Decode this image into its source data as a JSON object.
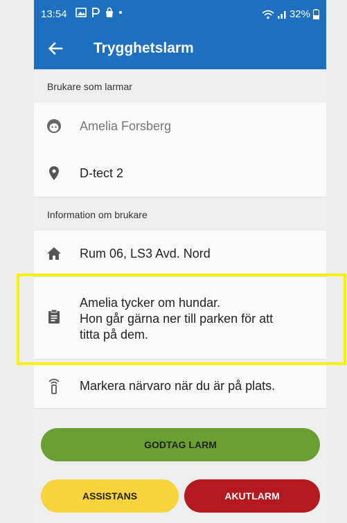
{
  "status_bar": {
    "time": "13:54",
    "battery": "32%",
    "icons": [
      "image-icon",
      "parking-icon",
      "bag-icon",
      "dot-icon",
      "wifi-icon",
      "signal-icon",
      "battery-icon"
    ]
  },
  "app_bar": {
    "title": "Trygghetslarm",
    "color": "#1d6fbf"
  },
  "sections": {
    "user_header": "Brukare som larmar",
    "info_header": "Information om brukare"
  },
  "user": {
    "name": "Amelia Forsberg",
    "device": "D-tect 2"
  },
  "info": {
    "room": "Rum 06, LS3 Avd. Nord",
    "note_lines": [
      "Amelia tycker om hundar.",
      "Hon går gärna ner till parken för att",
      "titta på dem."
    ]
  },
  "presence_hint": "Markera närvaro när du är på plats.",
  "buttons": {
    "accept": "GODTAG LARM",
    "assist": "ASSISTANS",
    "emergency": "AKUTLARM"
  },
  "colors": {
    "accept": "#6aa032",
    "assist": "#f7d43b",
    "emergency": "#b3191f",
    "highlight": "#f6f200"
  }
}
